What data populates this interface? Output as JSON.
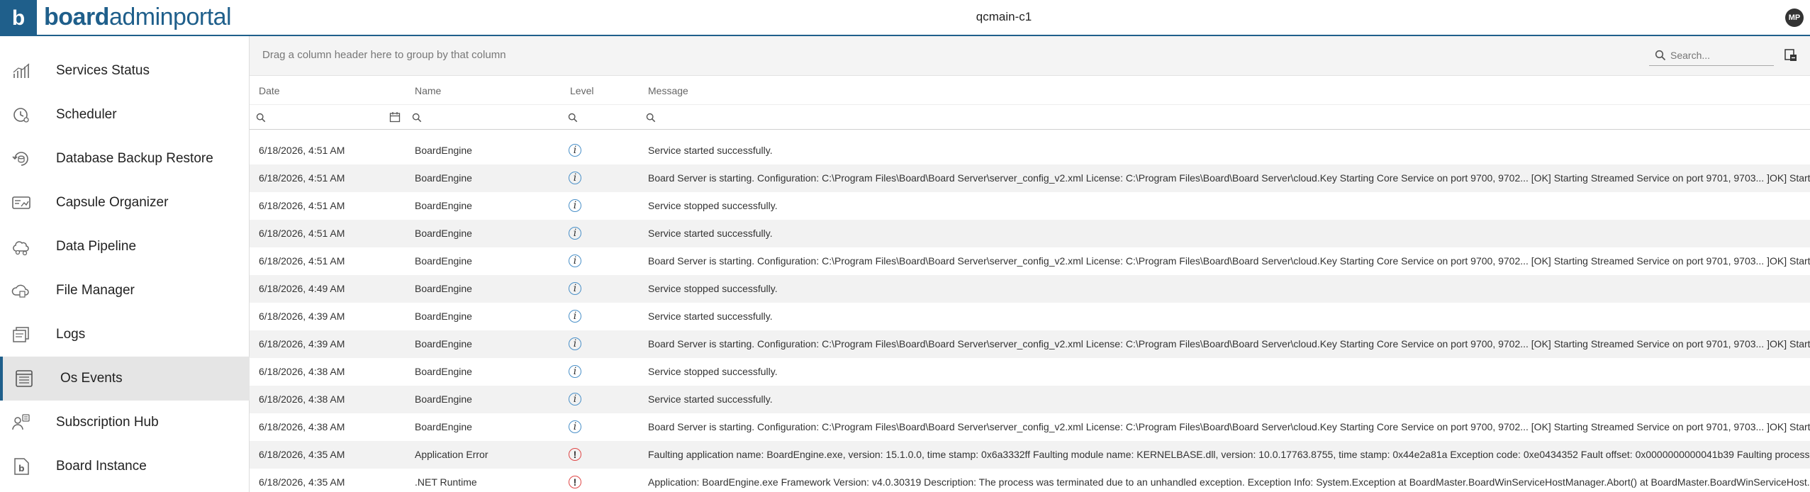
{
  "header": {
    "logo_letter": "b",
    "brand_bold": "board",
    "brand_light": "adminportal",
    "instance_title": "qcmain-c1",
    "avatar_initials": "MP",
    "accent_color": "#1f5f8b"
  },
  "sidebar": {
    "items": [
      {
        "label": "Services Status",
        "icon": "services-status-chart-icon",
        "active": false
      },
      {
        "label": "Scheduler",
        "icon": "scheduler-clock-icon",
        "active": false
      },
      {
        "label": "Database Backup Restore",
        "icon": "database-backup-icon",
        "active": false
      },
      {
        "label": "Capsule Organizer",
        "icon": "capsule-organizer-icon",
        "active": false
      },
      {
        "label": "Data Pipeline",
        "icon": "data-pipeline-icon",
        "active": false
      },
      {
        "label": "File Manager",
        "icon": "file-manager-cloud-icon",
        "active": false
      },
      {
        "label": "Logs",
        "icon": "logs-icon",
        "active": false
      },
      {
        "label": "Os Events",
        "icon": "os-events-icon",
        "active": true
      },
      {
        "label": "Subscription Hub",
        "icon": "subscription-hub-icon",
        "active": false
      },
      {
        "label": "Board Instance",
        "icon": "board-instance-icon",
        "active": false
      }
    ]
  },
  "grid": {
    "group_hint": "Drag a column header here to group by that column",
    "search_placeholder": "Search...",
    "columns": [
      "Date",
      "Name",
      "Level",
      "Message"
    ],
    "rows": [
      {
        "date": "6/18/2026, 4:51 AM",
        "name": "BoardEngine",
        "level": "info",
        "message": "Service started successfully."
      },
      {
        "date": "6/18/2026, 4:51 AM",
        "name": "BoardEngine",
        "level": "info",
        "message": "Board Server is starting. Configuration: C:\\Program Files\\Board\\Board Server\\server_config_v2.xml License: C:\\Program Files\\Board\\Board Server\\cloud.Key Starting Core Service on port 9700, 9702... [OK] Starting Streamed Service on port 9701, 9703... ]OK] Startin..."
      },
      {
        "date": "6/18/2026, 4:51 AM",
        "name": "BoardEngine",
        "level": "info",
        "message": "Service stopped successfully."
      },
      {
        "date": "6/18/2026, 4:51 AM",
        "name": "BoardEngine",
        "level": "info",
        "message": "Service started successfully."
      },
      {
        "date": "6/18/2026, 4:51 AM",
        "name": "BoardEngine",
        "level": "info",
        "message": "Board Server is starting. Configuration: C:\\Program Files\\Board\\Board Server\\server_config_v2.xml License: C:\\Program Files\\Board\\Board Server\\cloud.Key Starting Core Service on port 9700, 9702... [OK] Starting Streamed Service on port 9701, 9703... ]OK] Startin..."
      },
      {
        "date": "6/18/2026, 4:49 AM",
        "name": "BoardEngine",
        "level": "info",
        "message": "Service stopped successfully."
      },
      {
        "date": "6/18/2026, 4:39 AM",
        "name": "BoardEngine",
        "level": "info",
        "message": "Service started successfully."
      },
      {
        "date": "6/18/2026, 4:39 AM",
        "name": "BoardEngine",
        "level": "info",
        "message": "Board Server is starting. Configuration: C:\\Program Files\\Board\\Board Server\\server_config_v2.xml License: C:\\Program Files\\Board\\Board Server\\cloud.Key Starting Core Service on port 9700, 9702... [OK] Starting Streamed Service on port 9701, 9703... ]OK] Startin..."
      },
      {
        "date": "6/18/2026, 4:38 AM",
        "name": "BoardEngine",
        "level": "info",
        "message": "Service stopped successfully."
      },
      {
        "date": "6/18/2026, 4:38 AM",
        "name": "BoardEngine",
        "level": "info",
        "message": "Service started successfully."
      },
      {
        "date": "6/18/2026, 4:38 AM",
        "name": "BoardEngine",
        "level": "info",
        "message": "Board Server is starting. Configuration: C:\\Program Files\\Board\\Board Server\\server_config_v2.xml License: C:\\Program Files\\Board\\Board Server\\cloud.Key Starting Core Service on port 9700, 9702... [OK] Starting Streamed Service on port 9701, 9703... ]OK] Startin..."
      },
      {
        "date": "6/18/2026, 4:35 AM",
        "name": "Application Error",
        "level": "error",
        "message": "Faulting application name: BoardEngine.exe, version: 15.1.0.0, time stamp: 0x6a3332ff Faulting module name: KERNELBASE.dll, version: 10.0.17763.8755, time stamp: 0x44e2a81a Exception code: 0xe0434352 Fault offset: 0x0000000000041b39 Faulting process id: ..."
      },
      {
        "date": "6/18/2026, 4:35 AM",
        "name": ".NET Runtime",
        "level": "error",
        "message": "Application: BoardEngine.exe Framework Version: v4.0.30319 Description: The process was terminated due to an unhandled exception. Exception Info: System.Exception at BoardMaster.BoardWinServiceHostManager.Abort() at BoardMaster.BoardWinServiceHost..."
      }
    ]
  },
  "level_glyphs": {
    "info": "i",
    "error": "!"
  },
  "level_colors": {
    "info": "#4a90c8",
    "error": "#e04848"
  }
}
